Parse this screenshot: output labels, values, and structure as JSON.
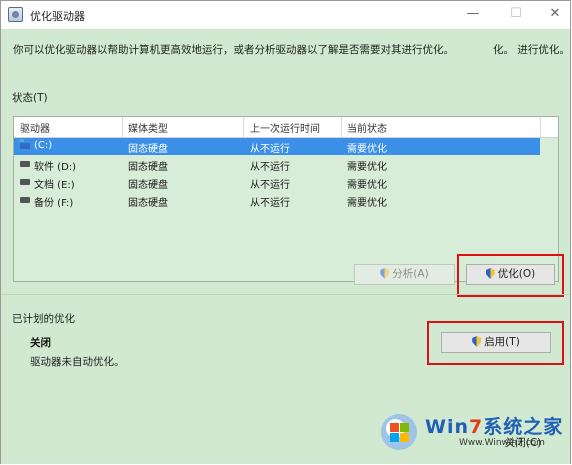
{
  "window": {
    "title": "优化驱动器",
    "controls": {
      "minimize": "—",
      "maximize": "☐",
      "close": "✕"
    }
  },
  "description": "你可以优化驱动器以帮助计算机更高效地运行，或者分析驱动器以了解是否需要对其进行优化。",
  "description_tail": "化。 进行优化。",
  "status_label": "状态(T)",
  "table": {
    "headers": [
      "驱动器",
      "媒体类型",
      "上一次运行时间",
      "当前状态"
    ],
    "rows": [
      {
        "drive": "(C:)",
        "media": "固态硬盘",
        "last_run": "从不运行",
        "status": "需要优化",
        "selected": true
      },
      {
        "drive": "软件 (D:)",
        "media": "固态硬盘",
        "last_run": "从不运行",
        "status": "需要优化",
        "selected": false
      },
      {
        "drive": "文档 (E:)",
        "media": "固态硬盘",
        "last_run": "从不运行",
        "status": "需要优化",
        "selected": false
      },
      {
        "drive": "备份 (F:)",
        "media": "固态硬盘",
        "last_run": "从不运行",
        "status": "需要优化",
        "selected": false
      }
    ]
  },
  "buttons": {
    "analyze": "分析(A)",
    "optimize": "优化(O)",
    "enable": "启用(T)",
    "close": "关闭(C)"
  },
  "scheduled": {
    "label": "已计划的优化",
    "state": "关闭",
    "description": "驱动器未自动优化。"
  },
  "watermark": {
    "brand_prefix": "Win",
    "brand_seven": "7",
    "brand_suffix": "系统之家",
    "url": "Www.Winwin7.com"
  },
  "colors": {
    "background": "#d1e9d1",
    "selection": "#3b8fe6",
    "highlight_border": "#dd1111"
  }
}
